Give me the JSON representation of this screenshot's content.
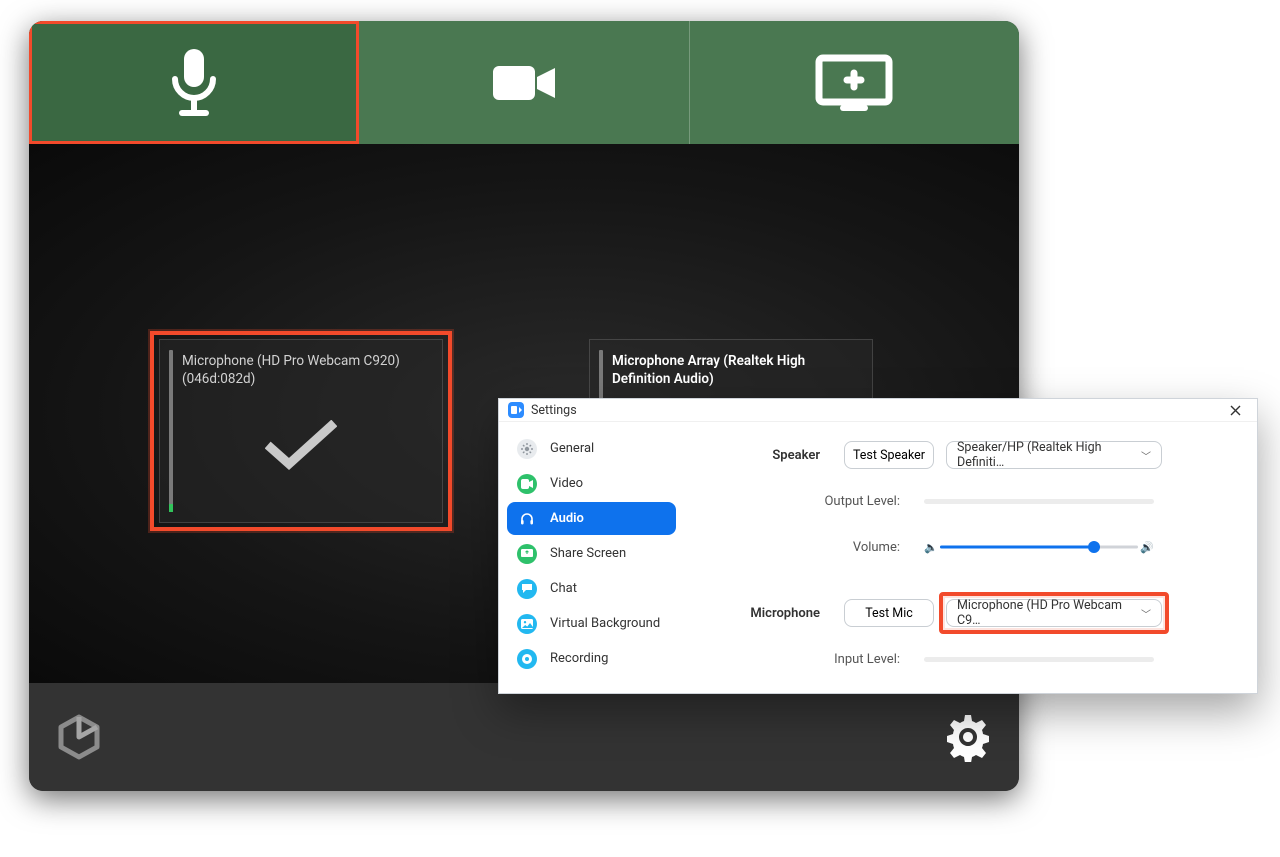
{
  "tabs": {
    "audio": {
      "active": true
    },
    "video": {
      "active": false
    },
    "share": {
      "active": false
    }
  },
  "micCards": {
    "selected": {
      "title": "Microphone (HD Pro Webcam C920)",
      "sub": "(046d:082d)"
    },
    "other": {
      "title": "Microphone Array (Realtek High Definition Audio)"
    }
  },
  "settings": {
    "windowTitle": "Settings",
    "sidebar": [
      {
        "label": "General",
        "icon": "gear",
        "color": "#b7bdc3"
      },
      {
        "label": "Video",
        "icon": "video",
        "color": "#2ec16b"
      },
      {
        "label": "Audio",
        "icon": "headset",
        "color": "#0e72ed",
        "active": true
      },
      {
        "label": "Share Screen",
        "icon": "share",
        "color": "#2ec16b"
      },
      {
        "label": "Chat",
        "icon": "chat",
        "color": "#22b8f0"
      },
      {
        "label": "Virtual Background",
        "icon": "picture",
        "color": "#22b8f0"
      },
      {
        "label": "Recording",
        "icon": "record",
        "color": "#22b8f0"
      }
    ],
    "speaker": {
      "label": "Speaker",
      "testBtn": "Test Speaker",
      "device": "Speaker/HP (Realtek High Definiti…",
      "outputLevelLabel": "Output Level:",
      "volumeLabel": "Volume:"
    },
    "microphone": {
      "label": "Microphone",
      "testBtn": "Test Mic",
      "device": "Microphone (HD Pro Webcam C9…",
      "inputLevelLabel": "Input Level:"
    }
  }
}
